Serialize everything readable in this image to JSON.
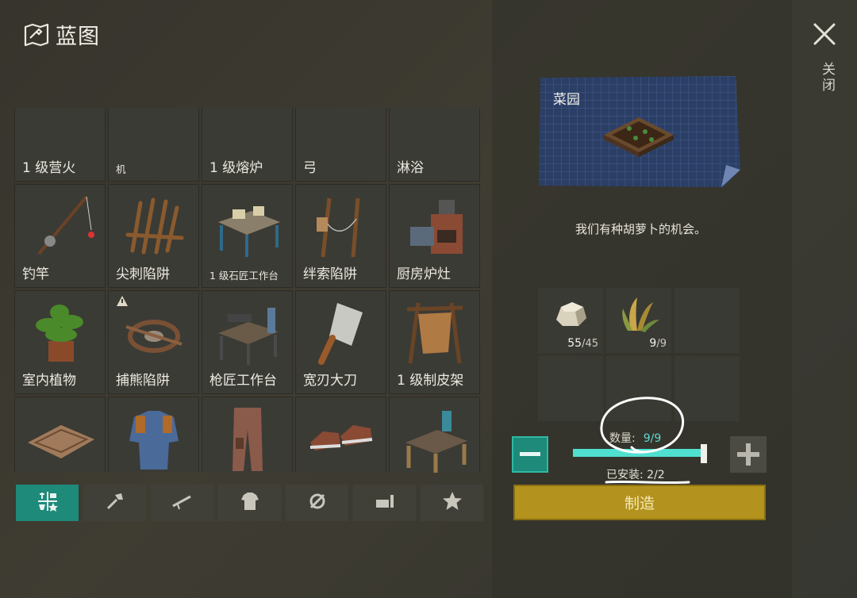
{
  "header": {
    "title": "蓝图",
    "icon": "blueprint-icon"
  },
  "grid": {
    "rows": [
      [
        {
          "label": "1 级营火",
          "icon": "campfire"
        },
        {
          "label": "机",
          "icon": "machine",
          "small": true
        },
        {
          "label": "1 级熔炉",
          "icon": "furnace"
        },
        {
          "label": "弓",
          "icon": "bow"
        },
        {
          "label": "淋浴",
          "icon": "shower"
        }
      ],
      [
        {
          "label": "钓竿",
          "icon": "fishing-rod"
        },
        {
          "label": "尖刺陷阱",
          "icon": "spike-trap"
        },
        {
          "label": "1 级石匠工作台",
          "icon": "mason-bench",
          "small": true
        },
        {
          "label": "绊索陷阱",
          "icon": "tripwire-trap"
        },
        {
          "label": "厨房炉灶",
          "icon": "kitchen-stove"
        }
      ],
      [
        {
          "label": "室内植物",
          "icon": "house-plant"
        },
        {
          "label": "捕熊陷阱",
          "icon": "bear-trap",
          "badge": true
        },
        {
          "label": "枪匠工作台",
          "icon": "gunsmith-bench"
        },
        {
          "label": "宽刃大刀",
          "icon": "cleaver"
        },
        {
          "label": "1 级制皮架",
          "icon": "tanning-rack"
        }
      ],
      [
        {
          "label": "门垫",
          "icon": "doormat"
        },
        {
          "label": "强化衬衫",
          "icon": "reinforced-shirt"
        },
        {
          "label": "强化裤子",
          "icon": "reinforced-pants"
        },
        {
          "label": "强化帆布鞋",
          "icon": "canvas-shoes"
        },
        {
          "label": "1 级工作台",
          "icon": "workbench"
        }
      ],
      [
        {
          "label": "",
          "icon": "partial"
        },
        {
          "label": "",
          "icon": "partial"
        },
        {
          "label": "",
          "icon": "partial"
        },
        {
          "label": "",
          "icon": "partial"
        },
        {
          "label": "",
          "icon": "partial"
        }
      ]
    ]
  },
  "tabs": [
    {
      "name": "all-icon",
      "active": true
    },
    {
      "name": "tools-icon",
      "active": false
    },
    {
      "name": "weapons-icon",
      "active": false
    },
    {
      "name": "clothing-icon",
      "active": false
    },
    {
      "name": "crafting-icon",
      "active": false
    },
    {
      "name": "furniture-icon",
      "active": false
    },
    {
      "name": "favorites-icon",
      "active": false
    }
  ],
  "detail": {
    "name": "菜园",
    "description": "我们有种胡萝卜的机会。",
    "ingredients": [
      {
        "icon": "stone-icon",
        "have": "55",
        "need": "45"
      },
      {
        "icon": "plant-fiber-icon",
        "have": "9",
        "need": "9"
      }
    ],
    "quantity_label": "数量:",
    "quantity_value": "9/9",
    "installed_label": "已安装: 2/2",
    "craft_label": "制造",
    "slider_fraction": 1.0
  },
  "close": {
    "label": "关闭"
  },
  "colors": {
    "accent": "#1d8a7a",
    "slider": "#4fe0d0",
    "craft": "#b3931e",
    "blueprint": "#2b3f66"
  }
}
